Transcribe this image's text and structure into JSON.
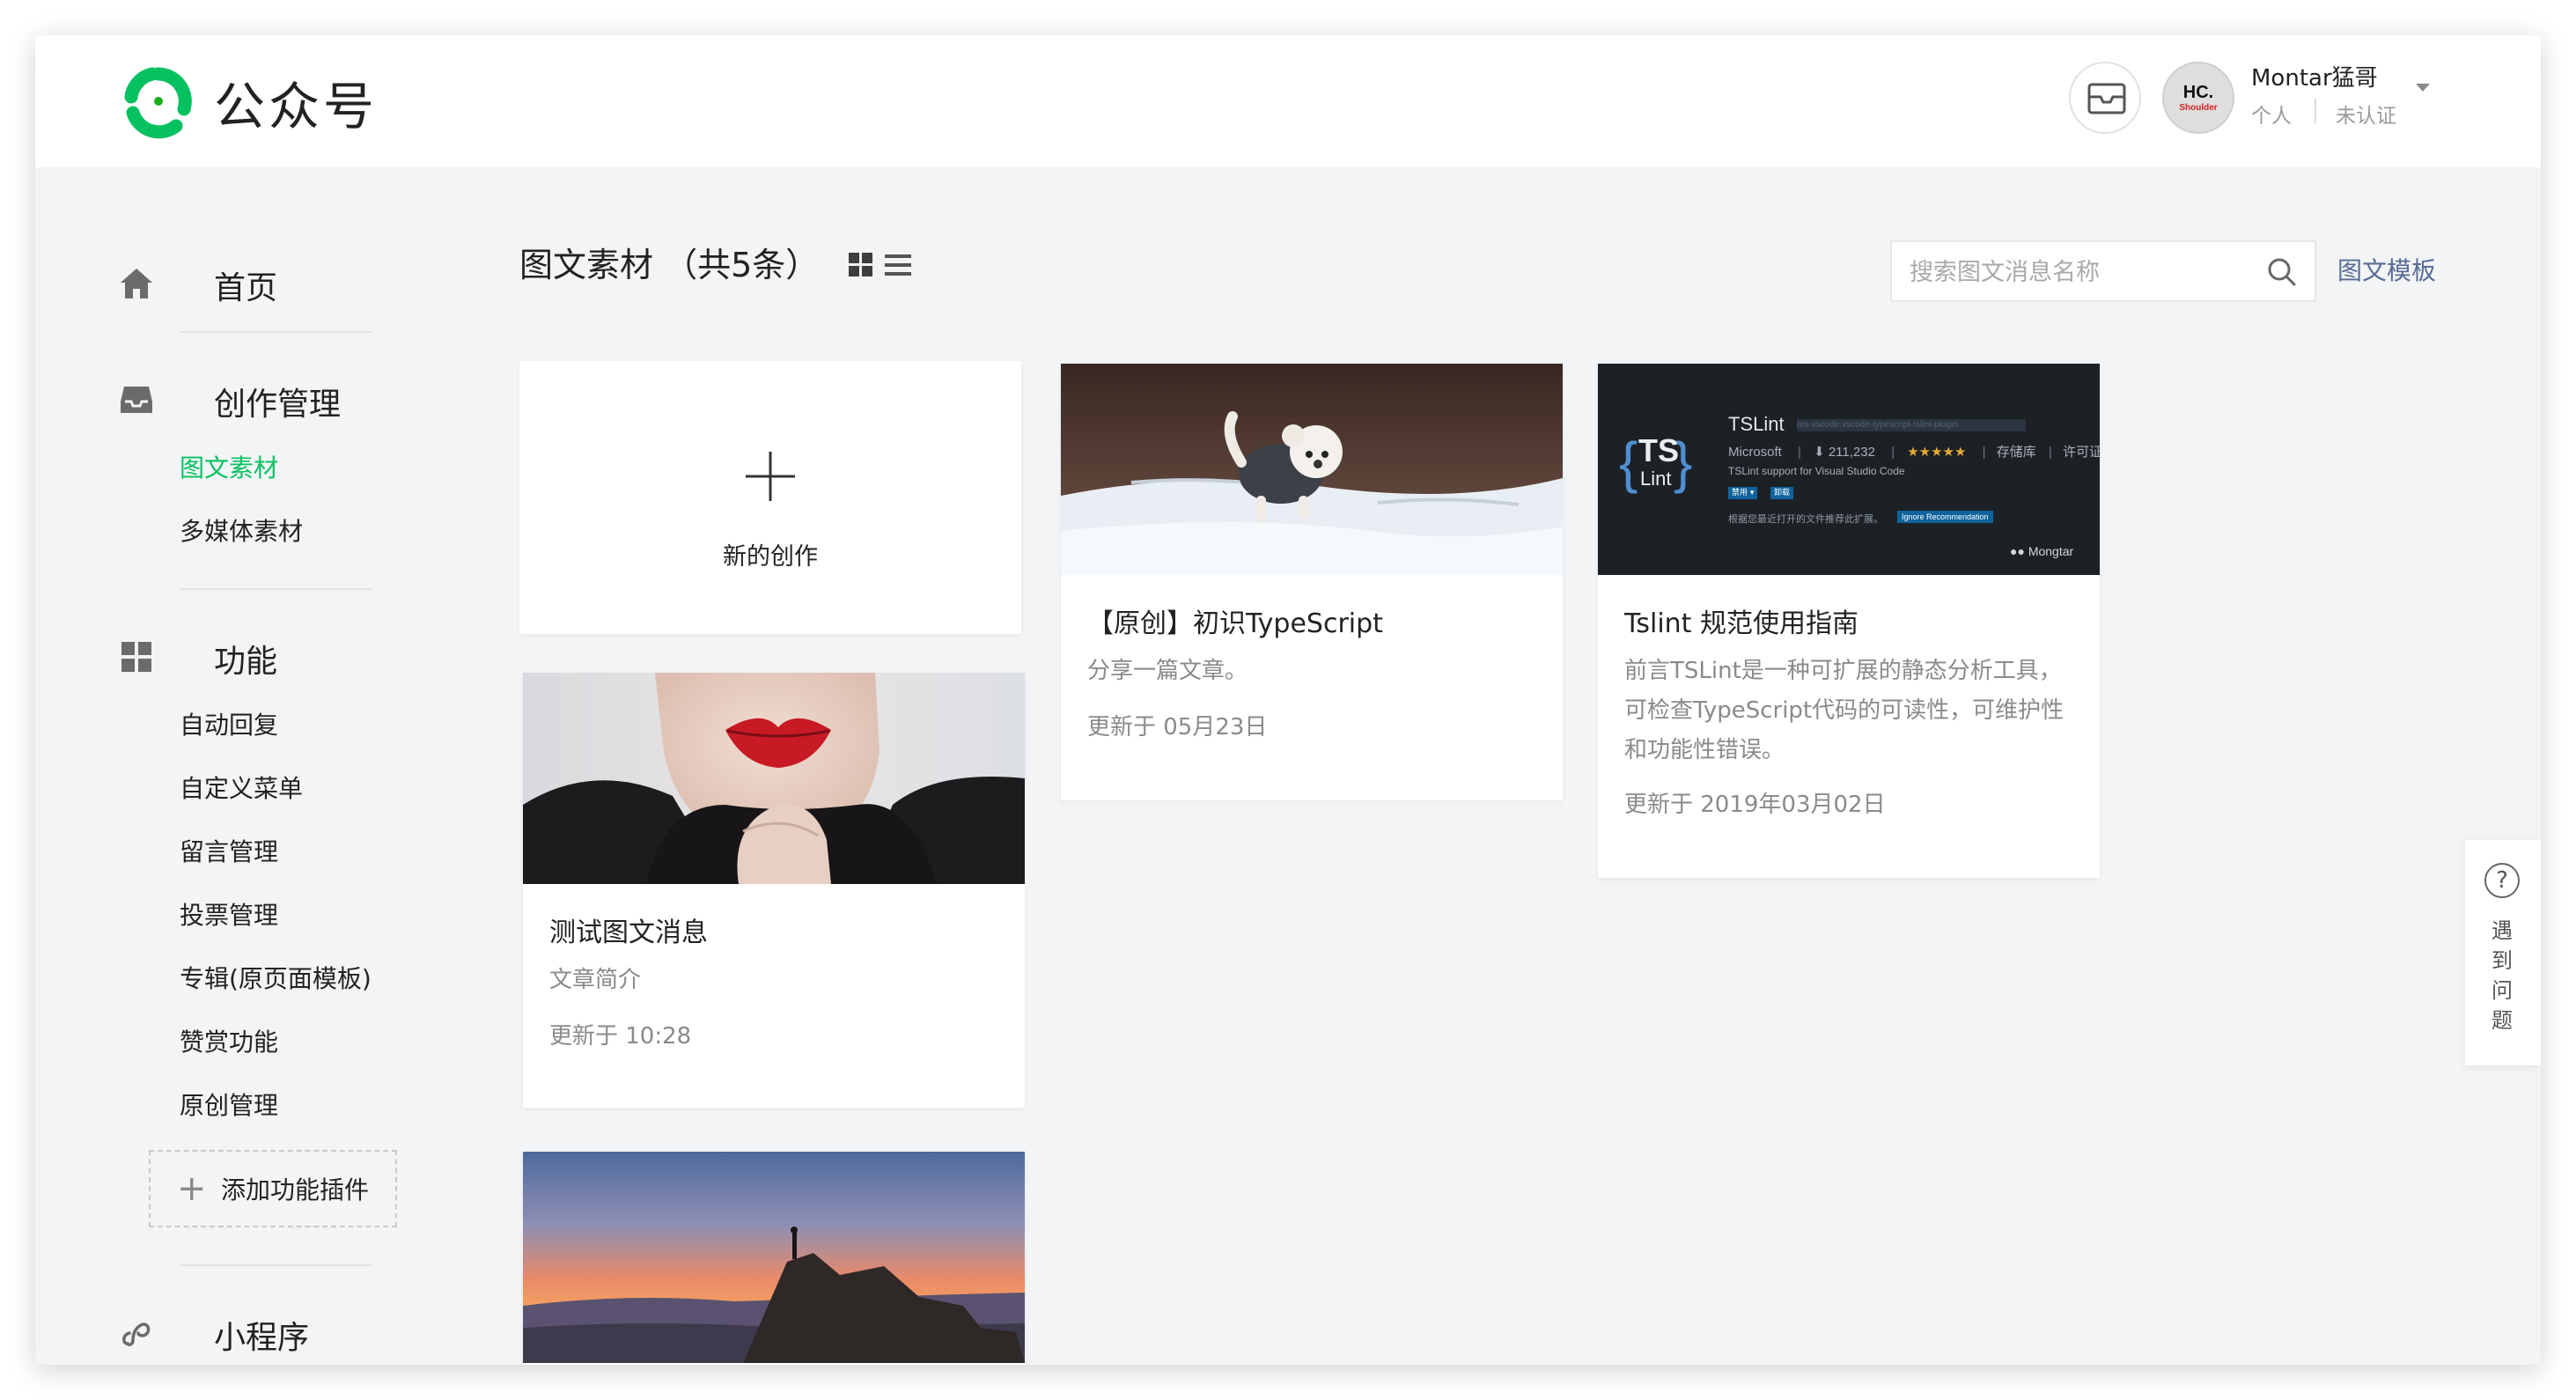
{
  "header": {
    "logo_text": "公众号",
    "user": {
      "avatar_line1": "HC.",
      "avatar_line2": "Shoulder",
      "name": "Montar猛哥",
      "account_type": "个人",
      "verify_status": "未认证"
    },
    "icons": [
      "mail-icon",
      "chevron-down-icon"
    ]
  },
  "sidebar": {
    "home": {
      "label": "首页",
      "icon": "home-icon"
    },
    "creation": {
      "label": "创作管理",
      "icon": "inbox-icon",
      "items": [
        {
          "label": "图文素材",
          "active": true
        },
        {
          "label": "多媒体素材",
          "active": false
        }
      ]
    },
    "features": {
      "label": "功能",
      "icon": "grid-icon",
      "items": [
        {
          "label": "自动回复"
        },
        {
          "label": "自定义菜单"
        },
        {
          "label": "留言管理"
        },
        {
          "label": "投票管理"
        },
        {
          "label": "专辑(原页面模板)"
        },
        {
          "label": "赞赏功能"
        },
        {
          "label": "原创管理"
        }
      ],
      "add_plugin": "添加功能插件"
    },
    "mini_program": {
      "label": "小程序",
      "icon": "link-icon"
    }
  },
  "main": {
    "title": "图文素材 （共5条）",
    "search": {
      "placeholder": "搜索图文消息名称",
      "value": ""
    },
    "template_link": "图文模板",
    "new_creation": "新的创作",
    "cards": [
      {
        "title": "测试图文消息",
        "digest": "文章简介",
        "updated": "更新于 10:28",
        "image": "red-lips-portrait"
      },
      {
        "title": "【原创】初识TypeScript",
        "digest": "分享一篇文章。",
        "updated": "更新于 05月23日",
        "image": "puppy-in-snow"
      },
      {
        "title": "Tslint 规范使用指南",
        "digest": "前言TSLint是一种可扩展的静态分析工具，可检查TypeScript代码的可读性，可维护性和功能性错误。",
        "updated": "更新于 2019年03月02日",
        "image": "tslint-extension"
      },
      {
        "image": "sunset-mountain"
      }
    ],
    "tslint_thumb": {
      "logo_top": "TS",
      "logo_bottom": "Lint",
      "name": "TSLint",
      "slug": "ms-vscode.vscode-typescript-tslint-plugin",
      "publisher": "Microsoft",
      "installs": "211,232",
      "stars": "★★★★★",
      "repo": "存储库",
      "license": "许可证",
      "desc": "TSLint support for Visual Studio Code",
      "tag1": "禁用 ▾",
      "tag2": "卸载",
      "note": "根据您最近打开的文件推荐此扩展。",
      "note_btn": "Ignore Recommendation",
      "watermark": "Mongtar"
    }
  },
  "help": {
    "label": "遇到问题"
  },
  "colors": {
    "accent": "#07c160",
    "link": "#576b95",
    "background": "#f2f4f6"
  }
}
